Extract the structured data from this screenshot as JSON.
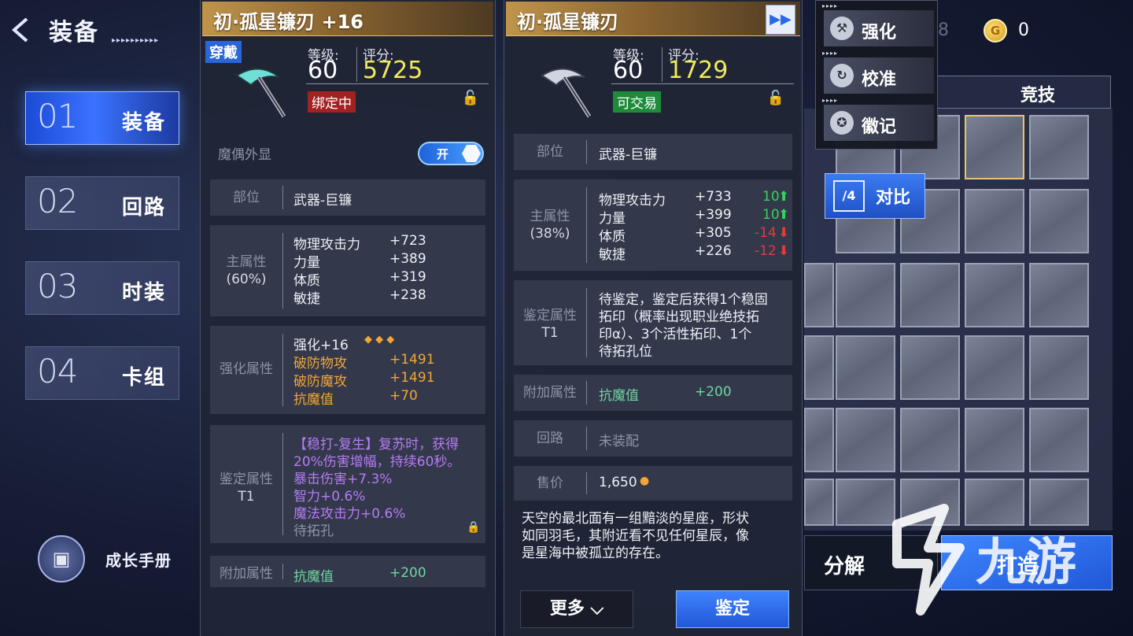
{
  "header": {
    "title": "装备",
    "back_icon": "back-arrow-icon"
  },
  "nav": [
    {
      "num": "01",
      "label": "装备",
      "active": true
    },
    {
      "num": "02",
      "label": "回路",
      "active": false
    },
    {
      "num": "03",
      "label": "时装",
      "active": false
    },
    {
      "num": "04",
      "label": "卡组",
      "active": false
    }
  ],
  "growth": {
    "label": "成长手册"
  },
  "equipped": {
    "name": "初·孤星镰刃 +16",
    "badge": "穿戴",
    "level_label": "等级:",
    "level": "60",
    "score_label": "评分:",
    "score": "5725",
    "bind_status": "绑定中",
    "puppet_label": "魔偶外显",
    "toggle_label": "开",
    "slot_label": "部位",
    "slot_value": "武器-巨镰",
    "main_label": "主属性",
    "main_pct": "(60%)",
    "main_stats": [
      {
        "name": "物理攻击力",
        "value": "+723"
      },
      {
        "name": "力量",
        "value": "+389"
      },
      {
        "name": "体质",
        "value": "+319"
      },
      {
        "name": "敏捷",
        "value": "+238"
      }
    ],
    "enhance_label": "强化属性",
    "enhance_level": "强化+16",
    "enhance_stats": [
      {
        "name": "破防物攻",
        "value": "+1491"
      },
      {
        "name": "破防魔攻",
        "value": "+1491"
      },
      {
        "name": "抗魔值",
        "value": "+70"
      }
    ],
    "appraise_label": "鉴定属性",
    "appraise_tier": "T1",
    "appraise_lines": [
      "【稳打-复生】复苏时，获得",
      "20%伤害增幅，持续60秒。",
      "暴击伤害+7.3%",
      "智力+0.6%",
      "魔法攻击力+0.6%",
      "待拓孔"
    ],
    "extra_label": "附加属性",
    "extra_stat_name": "抗魔值",
    "extra_stat_value": "+200"
  },
  "compare_item": {
    "name": "初·孤星镰刃",
    "level_label": "等级:",
    "level": "60",
    "score_label": "评分:",
    "score": "1729",
    "trade_status": "可交易",
    "slot_label": "部位",
    "slot_value": "武器-巨镰",
    "main_label": "主属性",
    "main_pct": "(38%)",
    "main_stats": [
      {
        "name": "物理攻击力",
        "value": "+733",
        "diff": "10",
        "dir": "up"
      },
      {
        "name": "力量",
        "value": "+399",
        "diff": "10",
        "dir": "up"
      },
      {
        "name": "体质",
        "value": "+305",
        "diff": "-14",
        "dir": "down"
      },
      {
        "name": "敏捷",
        "value": "+226",
        "diff": "-12",
        "dir": "down"
      }
    ],
    "appraise_label": "鉴定属性",
    "appraise_tier": "T1",
    "appraise_lines": [
      "待鉴定，鉴定后获得1个稳固",
      "拓印（概率出现职业绝技拓",
      "印α）、3个活性拓印、1个",
      "待拓孔位"
    ],
    "extra_label": "附加属性",
    "extra_stat_name": "抗魔值",
    "extra_stat_value": "+200",
    "circuit_label": "回路",
    "circuit_value": "未装配",
    "price_label": "售价",
    "price_value": "1,650",
    "description": [
      "天空的最北面有一组黯淡的星座，形状",
      "如同羽毛，其附近看不见任何星辰，像",
      "是星海中被孤立的存在。"
    ],
    "more_label": "更多",
    "identify_label": "鉴定"
  },
  "popup_menu": [
    {
      "label": "强化",
      "icon": "anvil-icon"
    },
    {
      "label": "校准",
      "icon": "calibrate-icon"
    },
    {
      "label": "徽记",
      "icon": "emblem-icon"
    }
  ],
  "inventory": {
    "faded_count": "41808",
    "currency": "0",
    "tab_label": "竞技",
    "compare_label": "对比",
    "decompose_label": "分解",
    "forge_label": "打造"
  },
  "watermark": "九游",
  "colors": {
    "accent": "#2f6cf0",
    "gold": "#f1ea5a",
    "up": "#35d35d",
    "down": "#e33b3b",
    "purple": "#b57cf5",
    "orange": "#f2a637"
  }
}
